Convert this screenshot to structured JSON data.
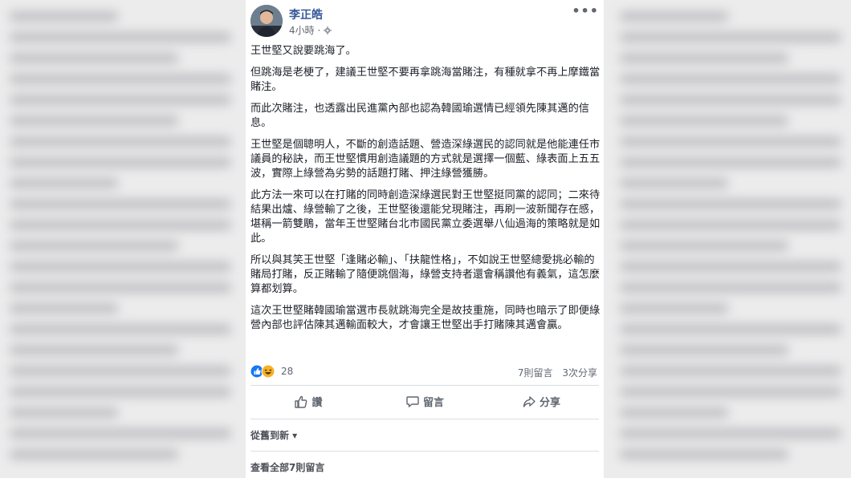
{
  "post": {
    "author": "李正皓",
    "time": "4小時 · ",
    "privacy_icon": "gear-icon",
    "more_icon": "ellipsis-icon",
    "more": "•••",
    "paragraphs": [
      "王世堅又說要跳海了。",
      "但跳海是老梗了，建議王世堅不要再拿跳海當賭注，有種就拿不再上摩鐵當賭注。",
      "而此次賭注，也透露出民進黨內部也認為韓國瑜選情已經領先陳其邁的信息。",
      "王世堅是個聰明人，不斷的創造話題、營造深綠選民的認同就是他能連任市議員的秘訣，而王世堅慣用創造議題的方式就是選擇一個藍、綠表面上五五波，實際上綠營為劣勢的話題打賭、押注綠營獲勝。",
      "此方法一來可以在打賭的同時創造深綠選民對王世堅挺同黨的認同；二來待結果出爐、綠營輸了之後，王世堅後還能兌現賭注，再刷一波新聞存在感，堪稱一箭雙鵰，當年王世堅賭台北市國民黨立委選舉八仙過海的策略就是如此。",
      "所以與其笑王世堅「逢賭必輸」、「扶龍性格」，不如說王世堅總愛挑必輸的賭局打賭，反正賭輸了隨便跳個海，綠營支持者還會稱讚他有義氣，這怎麼算都划算。",
      "這次王世堅賭韓國瑜當選市長就跳海完全是故技重施，同時也暗示了即便綠營內部也評估陳其邁輸面較大，才會讓王世堅出手打賭陳其邁會贏。"
    ]
  },
  "reactions": {
    "count": "28",
    "comments": "7則留言",
    "shares": "3次分享"
  },
  "actions": {
    "like": "讚",
    "comment": "留言",
    "share": "分享"
  },
  "comments_section": {
    "sort": "從舊到新 ▾",
    "view_all": "查看全部7則留言"
  },
  "colors": {
    "link_blue": "#365899",
    "like_blue": "#1877f2",
    "haha_yellow": "#f7b125",
    "text": "#1d2129",
    "muted": "#606770"
  }
}
